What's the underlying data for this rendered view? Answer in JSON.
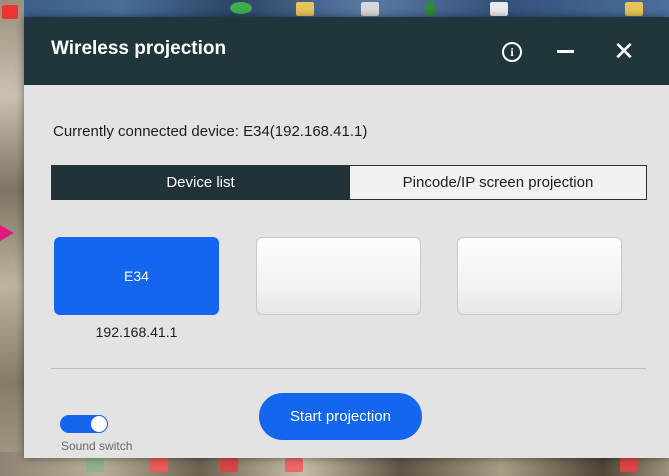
{
  "window": {
    "title": "Wireless projection",
    "info_icon": "info-icon",
    "minimize_icon": "minimize-icon",
    "close_icon": "close-icon",
    "close_glyph": "✕",
    "info_glyph": "i"
  },
  "status": {
    "connected_text": "Currently connected device: E34(192.168.41.1)"
  },
  "tabs": [
    {
      "label": "Device list",
      "active": true
    },
    {
      "label": "Pincode/IP screen projection",
      "active": false
    }
  ],
  "devices": [
    {
      "name": "E34",
      "ip": "192.168.41.1",
      "selected": true
    },
    {
      "name": "",
      "ip": "",
      "selected": false
    },
    {
      "name": "",
      "ip": "",
      "selected": false
    }
  ],
  "footer": {
    "sound_switch_label": "Sound switch",
    "sound_switch_on": true,
    "start_button_label": "Start projection"
  },
  "colors": {
    "titlebar": "#21363a",
    "accent": "#1466ee",
    "dialog_bg": "#e3e3e3"
  }
}
